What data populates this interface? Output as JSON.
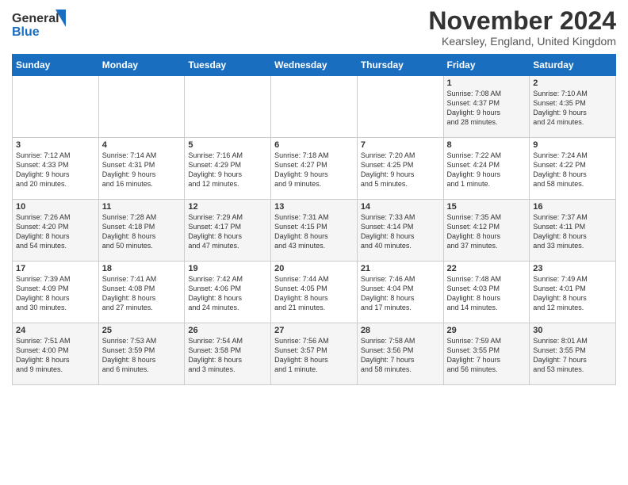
{
  "header": {
    "logo_line1": "General",
    "logo_line2": "Blue",
    "month": "November 2024",
    "location": "Kearsley, England, United Kingdom"
  },
  "days_of_week": [
    "Sunday",
    "Monday",
    "Tuesday",
    "Wednesday",
    "Thursday",
    "Friday",
    "Saturday"
  ],
  "weeks": [
    [
      {
        "day": "",
        "info": ""
      },
      {
        "day": "",
        "info": ""
      },
      {
        "day": "",
        "info": ""
      },
      {
        "day": "",
        "info": ""
      },
      {
        "day": "",
        "info": ""
      },
      {
        "day": "1",
        "info": "Sunrise: 7:08 AM\nSunset: 4:37 PM\nDaylight: 9 hours\nand 28 minutes."
      },
      {
        "day": "2",
        "info": "Sunrise: 7:10 AM\nSunset: 4:35 PM\nDaylight: 9 hours\nand 24 minutes."
      }
    ],
    [
      {
        "day": "3",
        "info": "Sunrise: 7:12 AM\nSunset: 4:33 PM\nDaylight: 9 hours\nand 20 minutes."
      },
      {
        "day": "4",
        "info": "Sunrise: 7:14 AM\nSunset: 4:31 PM\nDaylight: 9 hours\nand 16 minutes."
      },
      {
        "day": "5",
        "info": "Sunrise: 7:16 AM\nSunset: 4:29 PM\nDaylight: 9 hours\nand 12 minutes."
      },
      {
        "day": "6",
        "info": "Sunrise: 7:18 AM\nSunset: 4:27 PM\nDaylight: 9 hours\nand 9 minutes."
      },
      {
        "day": "7",
        "info": "Sunrise: 7:20 AM\nSunset: 4:25 PM\nDaylight: 9 hours\nand 5 minutes."
      },
      {
        "day": "8",
        "info": "Sunrise: 7:22 AM\nSunset: 4:24 PM\nDaylight: 9 hours\nand 1 minute."
      },
      {
        "day": "9",
        "info": "Sunrise: 7:24 AM\nSunset: 4:22 PM\nDaylight: 8 hours\nand 58 minutes."
      }
    ],
    [
      {
        "day": "10",
        "info": "Sunrise: 7:26 AM\nSunset: 4:20 PM\nDaylight: 8 hours\nand 54 minutes."
      },
      {
        "day": "11",
        "info": "Sunrise: 7:28 AM\nSunset: 4:18 PM\nDaylight: 8 hours\nand 50 minutes."
      },
      {
        "day": "12",
        "info": "Sunrise: 7:29 AM\nSunset: 4:17 PM\nDaylight: 8 hours\nand 47 minutes."
      },
      {
        "day": "13",
        "info": "Sunrise: 7:31 AM\nSunset: 4:15 PM\nDaylight: 8 hours\nand 43 minutes."
      },
      {
        "day": "14",
        "info": "Sunrise: 7:33 AM\nSunset: 4:14 PM\nDaylight: 8 hours\nand 40 minutes."
      },
      {
        "day": "15",
        "info": "Sunrise: 7:35 AM\nSunset: 4:12 PM\nDaylight: 8 hours\nand 37 minutes."
      },
      {
        "day": "16",
        "info": "Sunrise: 7:37 AM\nSunset: 4:11 PM\nDaylight: 8 hours\nand 33 minutes."
      }
    ],
    [
      {
        "day": "17",
        "info": "Sunrise: 7:39 AM\nSunset: 4:09 PM\nDaylight: 8 hours\nand 30 minutes."
      },
      {
        "day": "18",
        "info": "Sunrise: 7:41 AM\nSunset: 4:08 PM\nDaylight: 8 hours\nand 27 minutes."
      },
      {
        "day": "19",
        "info": "Sunrise: 7:42 AM\nSunset: 4:06 PM\nDaylight: 8 hours\nand 24 minutes."
      },
      {
        "day": "20",
        "info": "Sunrise: 7:44 AM\nSunset: 4:05 PM\nDaylight: 8 hours\nand 21 minutes."
      },
      {
        "day": "21",
        "info": "Sunrise: 7:46 AM\nSunset: 4:04 PM\nDaylight: 8 hours\nand 17 minutes."
      },
      {
        "day": "22",
        "info": "Sunrise: 7:48 AM\nSunset: 4:03 PM\nDaylight: 8 hours\nand 14 minutes."
      },
      {
        "day": "23",
        "info": "Sunrise: 7:49 AM\nSunset: 4:01 PM\nDaylight: 8 hours\nand 12 minutes."
      }
    ],
    [
      {
        "day": "24",
        "info": "Sunrise: 7:51 AM\nSunset: 4:00 PM\nDaylight: 8 hours\nand 9 minutes."
      },
      {
        "day": "25",
        "info": "Sunrise: 7:53 AM\nSunset: 3:59 PM\nDaylight: 8 hours\nand 6 minutes."
      },
      {
        "day": "26",
        "info": "Sunrise: 7:54 AM\nSunset: 3:58 PM\nDaylight: 8 hours\nand 3 minutes."
      },
      {
        "day": "27",
        "info": "Sunrise: 7:56 AM\nSunset: 3:57 PM\nDaylight: 8 hours\nand 1 minute."
      },
      {
        "day": "28",
        "info": "Sunrise: 7:58 AM\nSunset: 3:56 PM\nDaylight: 7 hours\nand 58 minutes."
      },
      {
        "day": "29",
        "info": "Sunrise: 7:59 AM\nSunset: 3:55 PM\nDaylight: 7 hours\nand 56 minutes."
      },
      {
        "day": "30",
        "info": "Sunrise: 8:01 AM\nSunset: 3:55 PM\nDaylight: 7 hours\nand 53 minutes."
      }
    ]
  ]
}
